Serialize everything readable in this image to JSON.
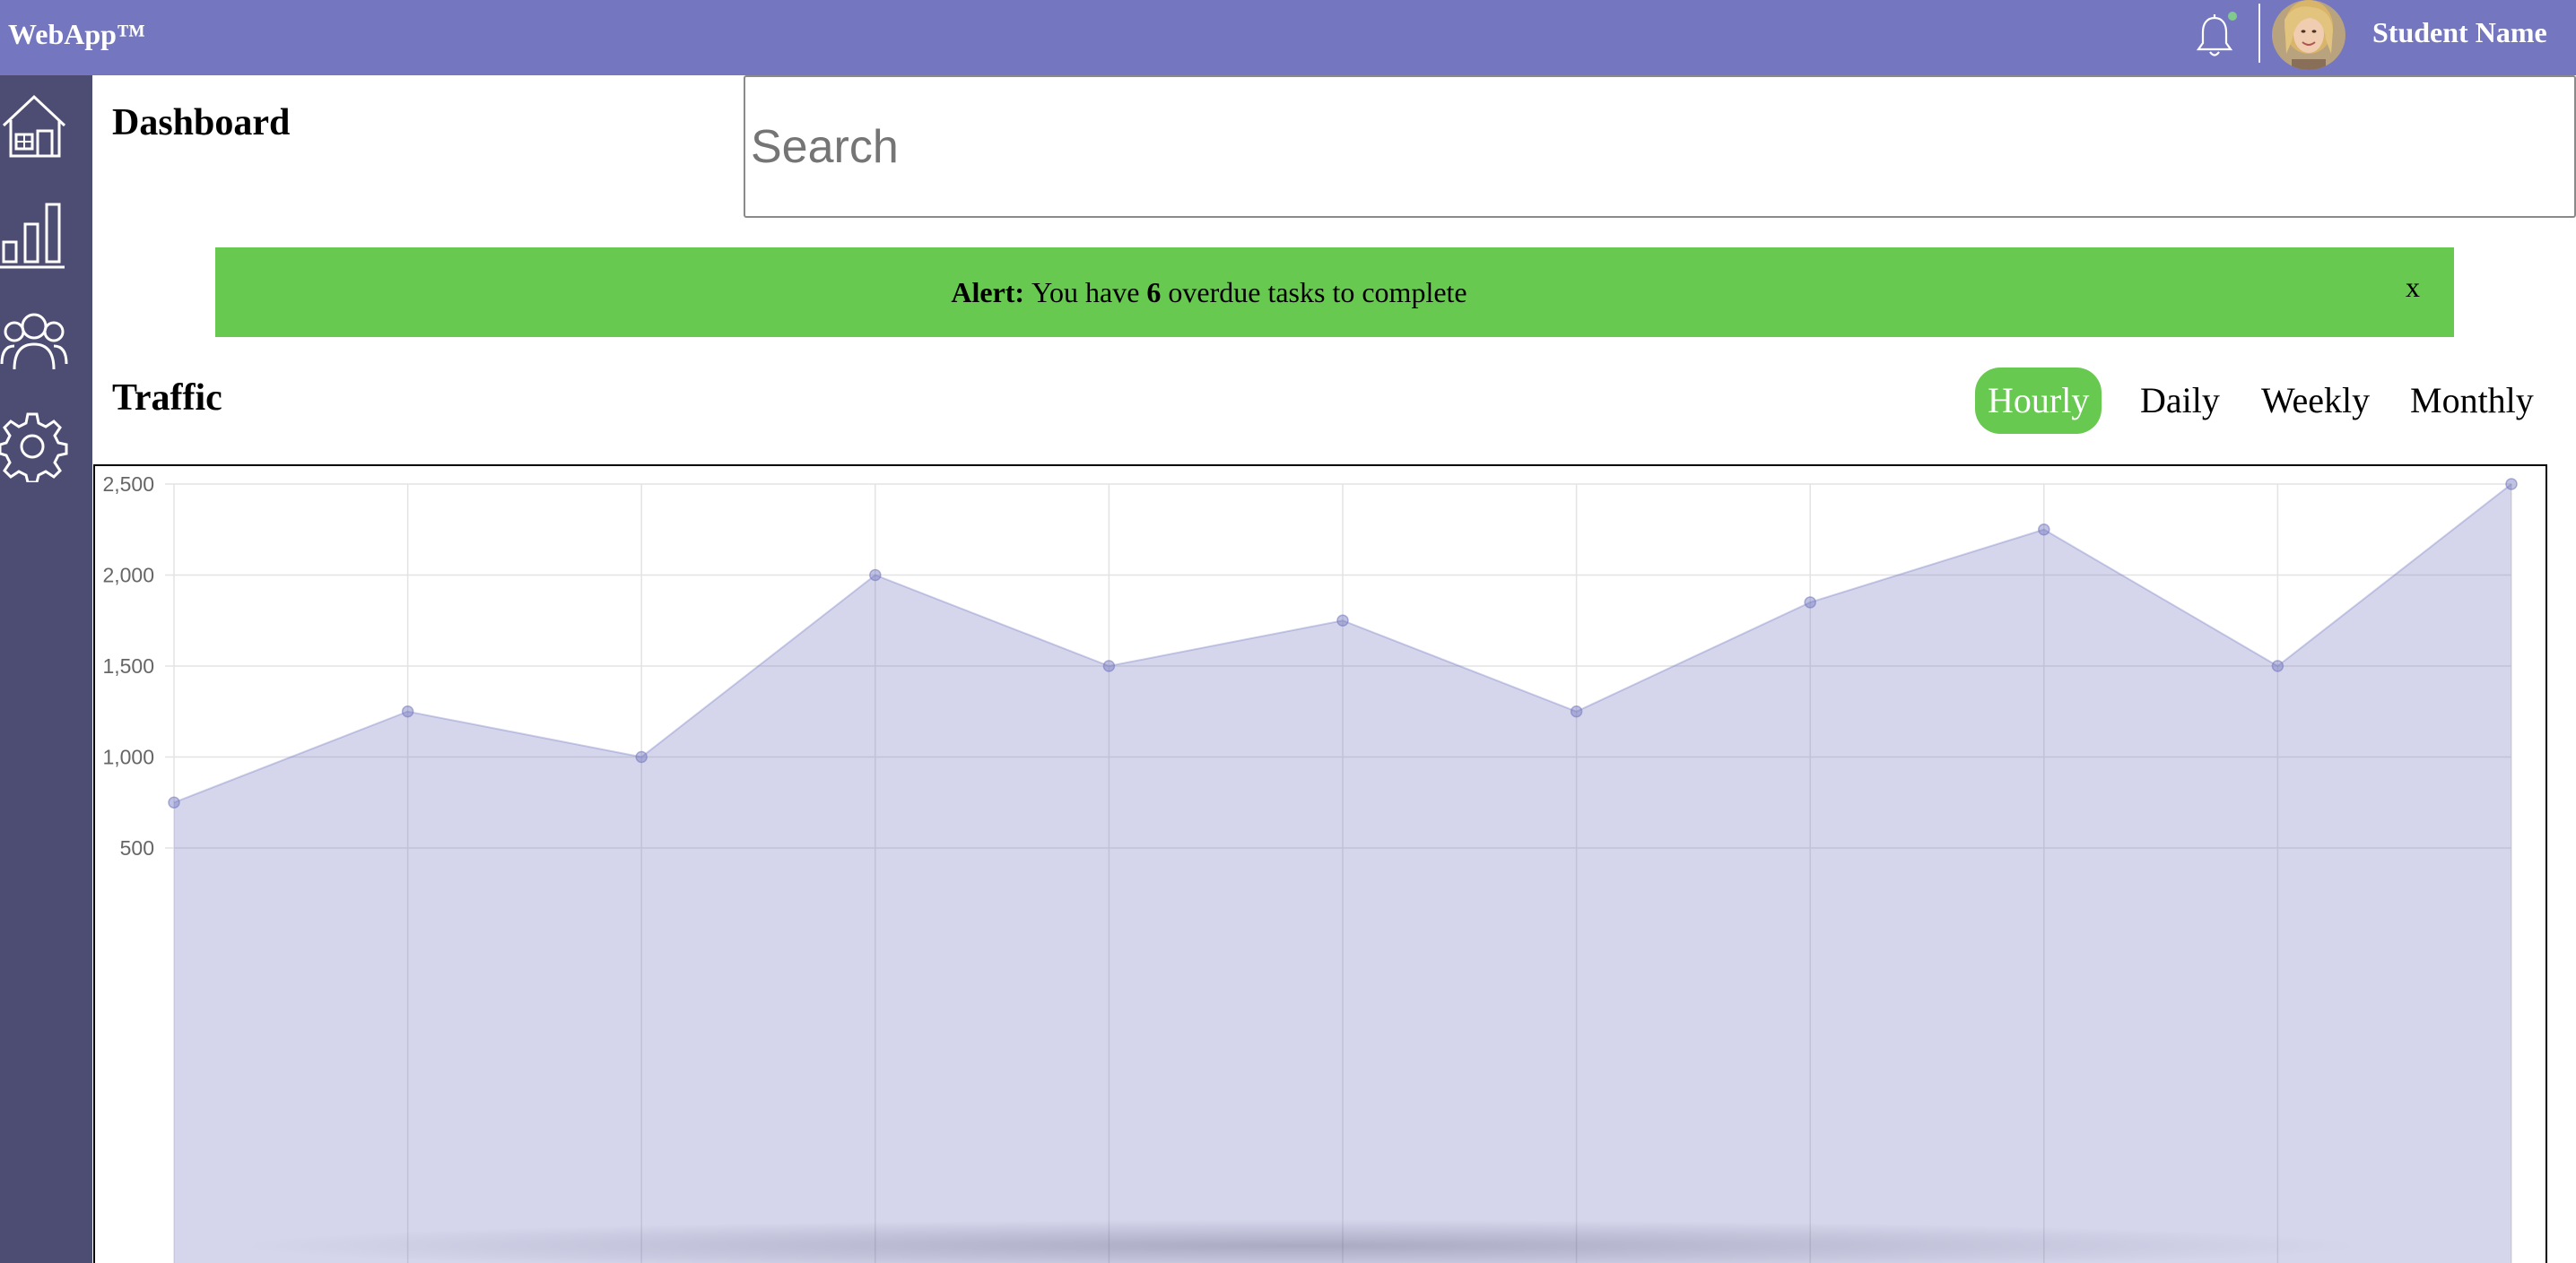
{
  "app": {
    "brand": "WebApp™"
  },
  "header": {
    "user_name": "Student Name",
    "notification_icon": "bell-icon",
    "avatar": "user-avatar"
  },
  "sidebar": {
    "items": [
      {
        "icon": "home-icon"
      },
      {
        "icon": "bar-chart-icon"
      },
      {
        "icon": "users-icon"
      },
      {
        "icon": "settings-icon"
      }
    ]
  },
  "page": {
    "title": "Dashboard"
  },
  "search": {
    "placeholder": "Search"
  },
  "alert": {
    "label": "Alert:",
    "text_before": "You have",
    "count": "6",
    "text_after": "overdue tasks to complete",
    "close": "x"
  },
  "traffic": {
    "title": "Traffic",
    "tabs": [
      {
        "label": "Hourly",
        "active": true
      },
      {
        "label": "Daily",
        "active": false
      },
      {
        "label": "Weekly",
        "active": false
      },
      {
        "label": "Monthly",
        "active": false
      }
    ]
  },
  "colors": {
    "topbar": "#7477bf",
    "sidebar": "#4d4c72",
    "accent": "#67c94f",
    "area": "#d5d6ea"
  },
  "chart_data": {
    "type": "area",
    "x": [
      1,
      2,
      3,
      4,
      5,
      6,
      7,
      8,
      9,
      10,
      11
    ],
    "values": [
      750,
      1250,
      1000,
      2000,
      1500,
      1750,
      1250,
      1850,
      2250,
      1500,
      2500
    ],
    "yticks": [
      "2,500",
      "2,000",
      "1,500",
      "1,000",
      "500"
    ],
    "ytick_values": [
      2500,
      2000,
      1500,
      1000,
      500
    ],
    "ylim": [
      500,
      2500
    ],
    "grid": true,
    "title": "",
    "xlabel": "",
    "ylabel": ""
  }
}
